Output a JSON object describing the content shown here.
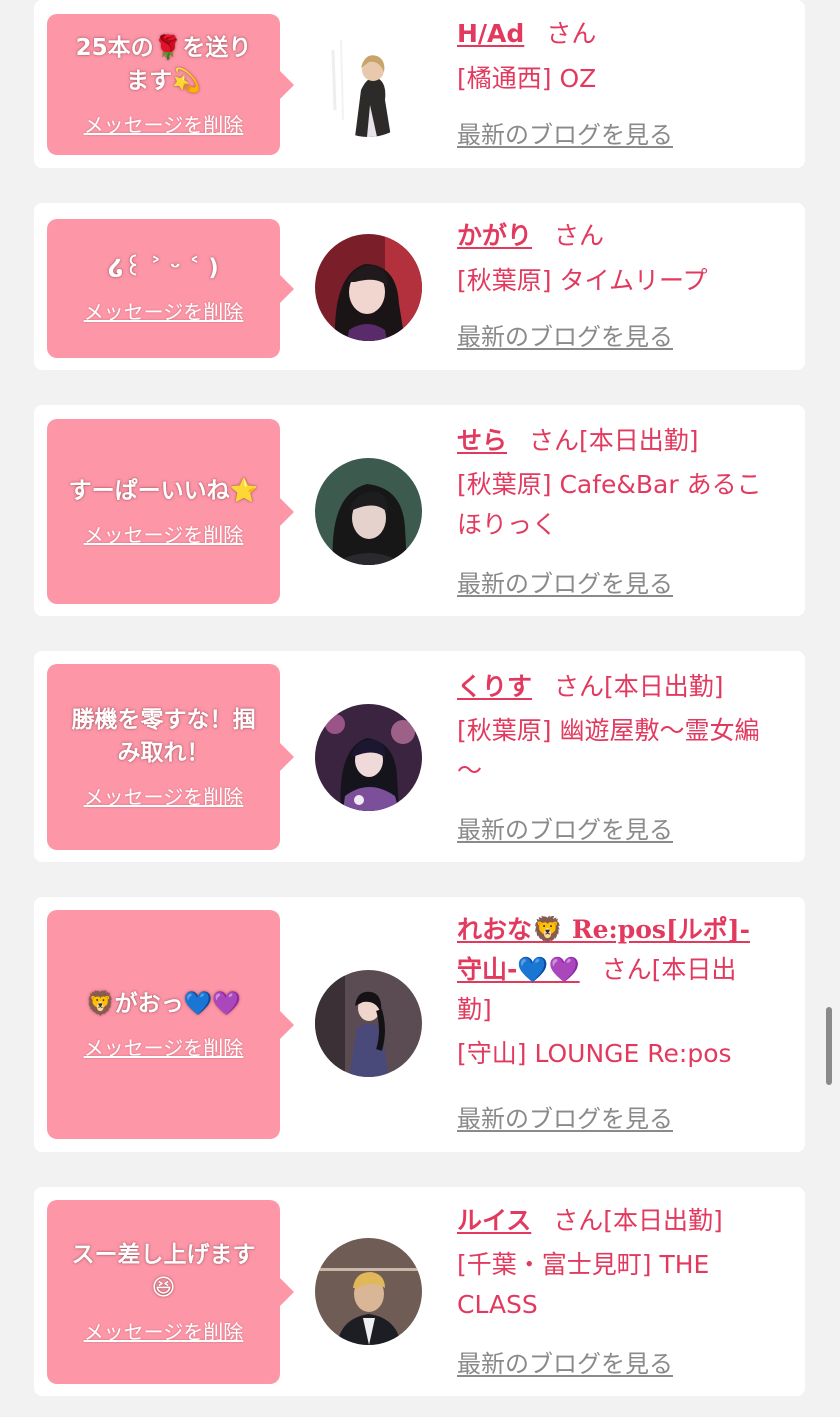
{
  "ui": {
    "delete_label": "メッセージを削除",
    "blog_label": "最新のブログを見る",
    "san": "さん"
  },
  "colors": {
    "page_bg": "#f2f2f2",
    "card_bg": "#ffffff",
    "bubble_bg": "#fd97a8",
    "accent": "#e23a5f",
    "muted": "#8a8a8a"
  },
  "items": [
    {
      "message_line1": "25本の🌹を送り",
      "message_line2": "ます💫",
      "name": "H/Ad",
      "suffix": "",
      "shop_line1": "[橘通西] OZ",
      "shop_line2": ""
    },
    {
      "message_line1": "໒꒰ ˃ ᵕ ˂ )",
      "message_line2": "",
      "name": "かがり",
      "suffix": "",
      "shop_line1": "[秋葉原] タイムリープ",
      "shop_line2": ""
    },
    {
      "message_line1": "すーぱーいいね⭐",
      "message_line2": "",
      "name": "せら",
      "suffix": "[本日出勤]",
      "shop_line1": "[秋葉原] Cafe&Bar あるこ",
      "shop_line2": "ほりっく"
    },
    {
      "message_line1": "勝機を零すな！掴",
      "message_line2": "み取れ！",
      "name": "くりす",
      "suffix": "[本日出勤]",
      "shop_line1": "[秋葉原] 幽遊屋敷〜霊女編",
      "shop_line2": "〜"
    },
    {
      "message_line1": "🦁がおっ💙💜",
      "message_line2": "",
      "name_line1": "れおな🦁 Re:pos[ルポ]-",
      "name_line2": "守山-💙💜",
      "suffix_a": "[本日出",
      "suffix_b": "勤]",
      "shop_line1": "[守山] LOUNGE Re:pos",
      "shop_line2": ""
    },
    {
      "message_line1": "スー差し上げます",
      "message_line2": "😆",
      "name": "ルイス",
      "suffix": "[本日出勤]",
      "shop_line1": "[千葉・富士見町] THE",
      "shop_line2": "CLASS"
    }
  ]
}
